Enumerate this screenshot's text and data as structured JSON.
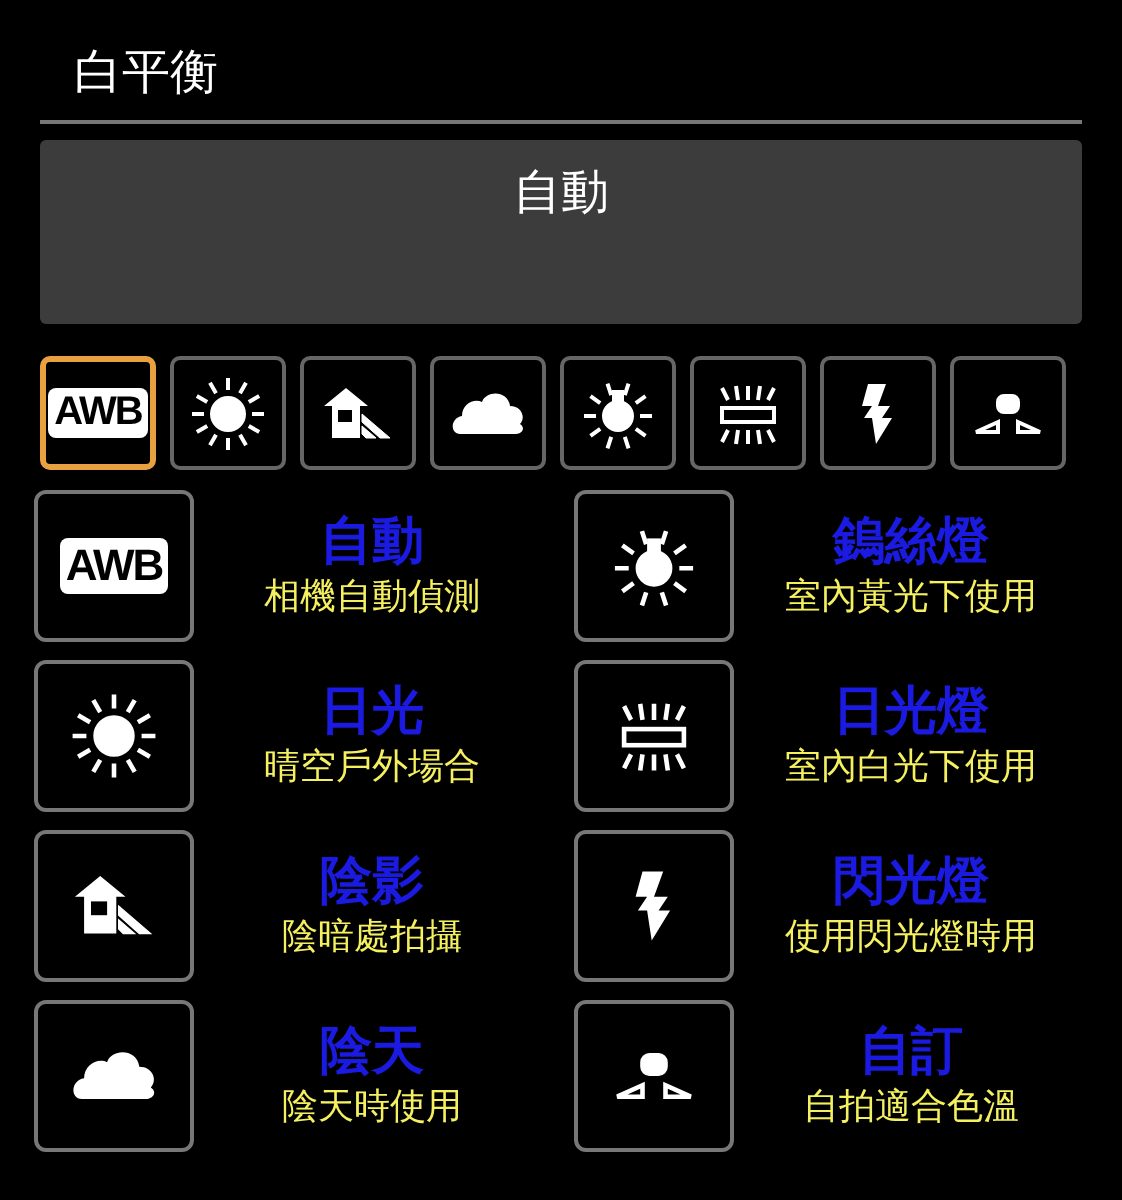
{
  "title": "白平衡",
  "current": {
    "label": "自動"
  },
  "modes": [
    {
      "kind": "awb",
      "text": "AWB",
      "selected": true
    },
    {
      "kind": "sun",
      "selected": false
    },
    {
      "kind": "shade",
      "selected": false
    },
    {
      "kind": "cloud",
      "selected": false
    },
    {
      "kind": "bulb",
      "selected": false
    },
    {
      "kind": "fluorescent",
      "selected": false
    },
    {
      "kind": "flash",
      "selected": false
    },
    {
      "kind": "custom",
      "selected": false
    }
  ],
  "legend": [
    {
      "kind": "awb",
      "text": "AWB",
      "title": "自動",
      "desc": "相機自動偵測"
    },
    {
      "kind": "bulb",
      "title": "鎢絲燈",
      "desc": "室內黃光下使用"
    },
    {
      "kind": "sun",
      "title": "日光",
      "desc": "晴空戶外場合"
    },
    {
      "kind": "fluorescent",
      "title": "日光燈",
      "desc": "室內白光下使用"
    },
    {
      "kind": "shade",
      "title": "陰影",
      "desc": "陰暗處拍攝"
    },
    {
      "kind": "flash",
      "title": "閃光燈",
      "desc": "使用閃光燈時用"
    },
    {
      "kind": "cloud",
      "title": "陰天",
      "desc": "陰天時使用"
    },
    {
      "kind": "custom",
      "title": "自訂",
      "desc": "自拍適合色溫"
    }
  ]
}
